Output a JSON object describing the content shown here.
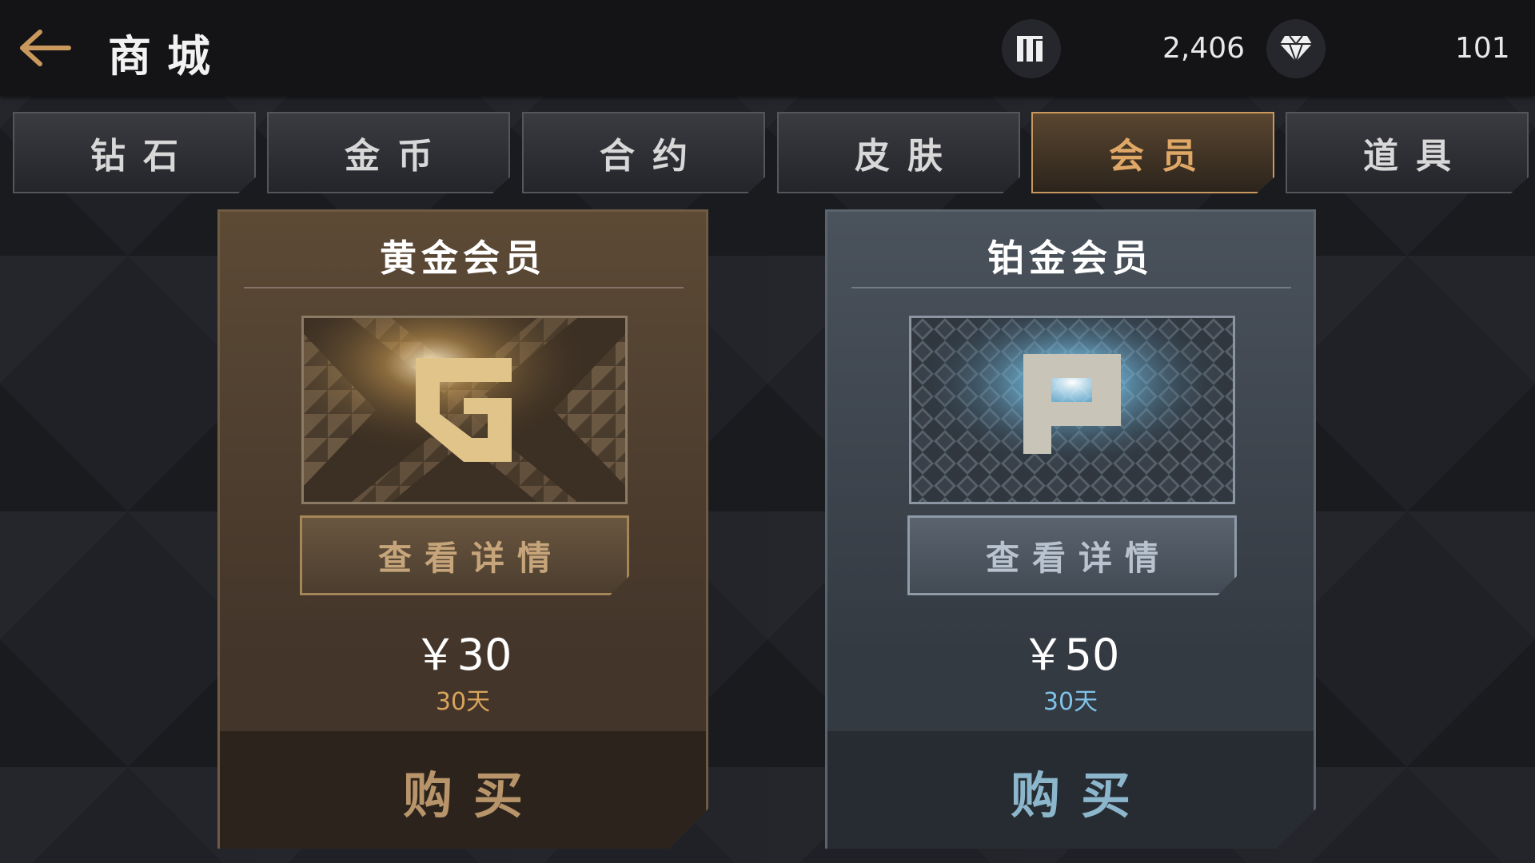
{
  "header": {
    "back_icon": "arrow-left-icon",
    "title": "商城",
    "currency_1": {
      "icon": "coin-stack-icon",
      "value": "2,406"
    },
    "currency_2": {
      "icon": "diamond-icon",
      "value": "101"
    }
  },
  "tabs": [
    {
      "label": "钻石",
      "active": false
    },
    {
      "label": "金币",
      "active": false
    },
    {
      "label": "合约",
      "active": false
    },
    {
      "label": "皮肤",
      "active": false
    },
    {
      "label": "会员",
      "active": true
    },
    {
      "label": "道具",
      "active": false
    }
  ],
  "cards": [
    {
      "title": "黄金会员",
      "emblem_icon": "gold-g-emblem-icon",
      "detail_label": "查看详情",
      "price": "￥30",
      "duration": "30天",
      "buy_label": "购买",
      "accent": "#d8a45c"
    },
    {
      "title": "铂金会员",
      "emblem_icon": "platinum-p-emblem-icon",
      "detail_label": "查看详情",
      "price": "￥50",
      "duration": "30天",
      "buy_label": "购买",
      "accent": "#7fc3e8"
    }
  ],
  "colors": {
    "accent_gold": "#c9985c",
    "accent_platinum": "#7fc3e8",
    "background": "#202126"
  }
}
